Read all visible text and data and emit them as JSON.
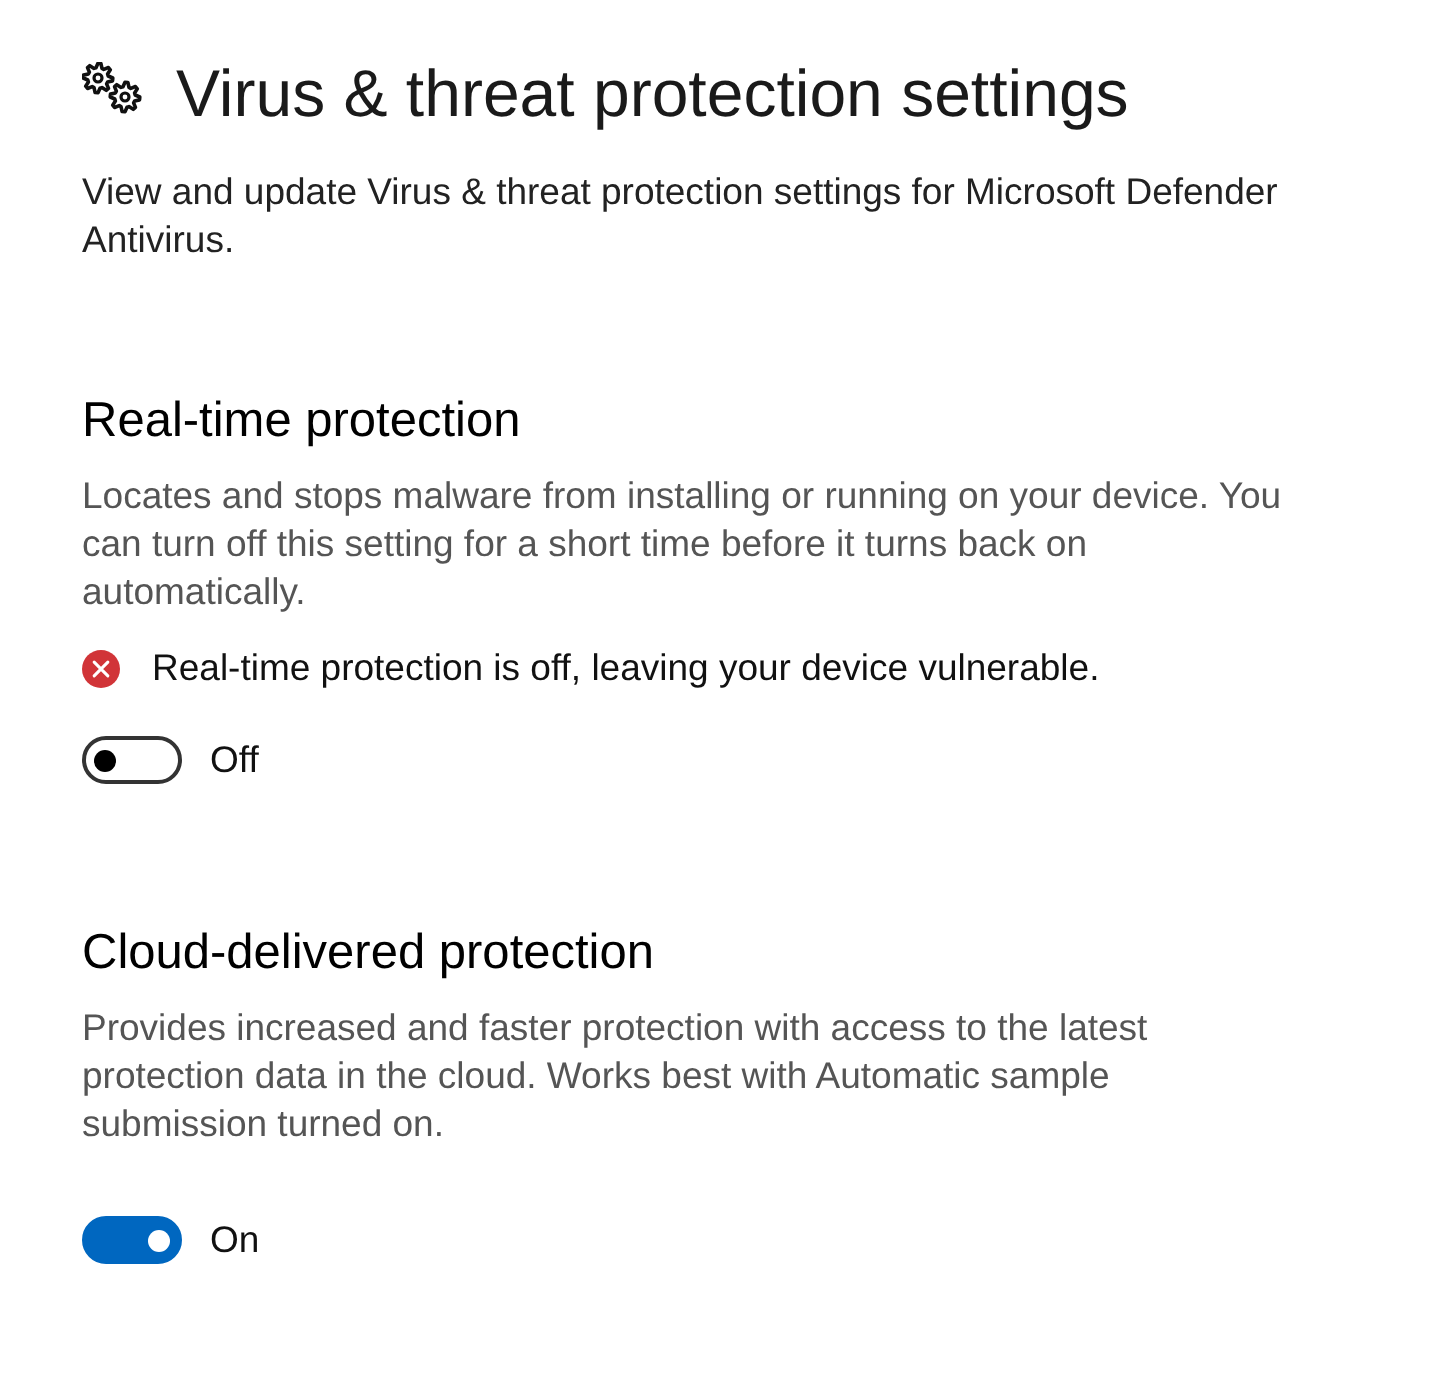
{
  "page": {
    "title": "Virus & threat protection settings",
    "description": "View and update Virus & threat protection settings for Microsoft Defender Antivirus."
  },
  "sections": [
    {
      "heading": "Real-time protection",
      "description": "Locates and stops malware from installing or running on your device. You can turn off this setting for a short time before it turns back on automatically.",
      "alert": {
        "kind": "error",
        "text": "Real-time protection is off, leaving your device vulnerable."
      },
      "toggle": {
        "on": false,
        "label": "Off"
      }
    },
    {
      "heading": "Cloud-delivered protection",
      "description": "Provides increased and faster protection with access to the latest protection data in the cloud. Works best with Automatic sample submission turned on.",
      "toggle": {
        "on": true,
        "label": "On"
      }
    }
  ]
}
